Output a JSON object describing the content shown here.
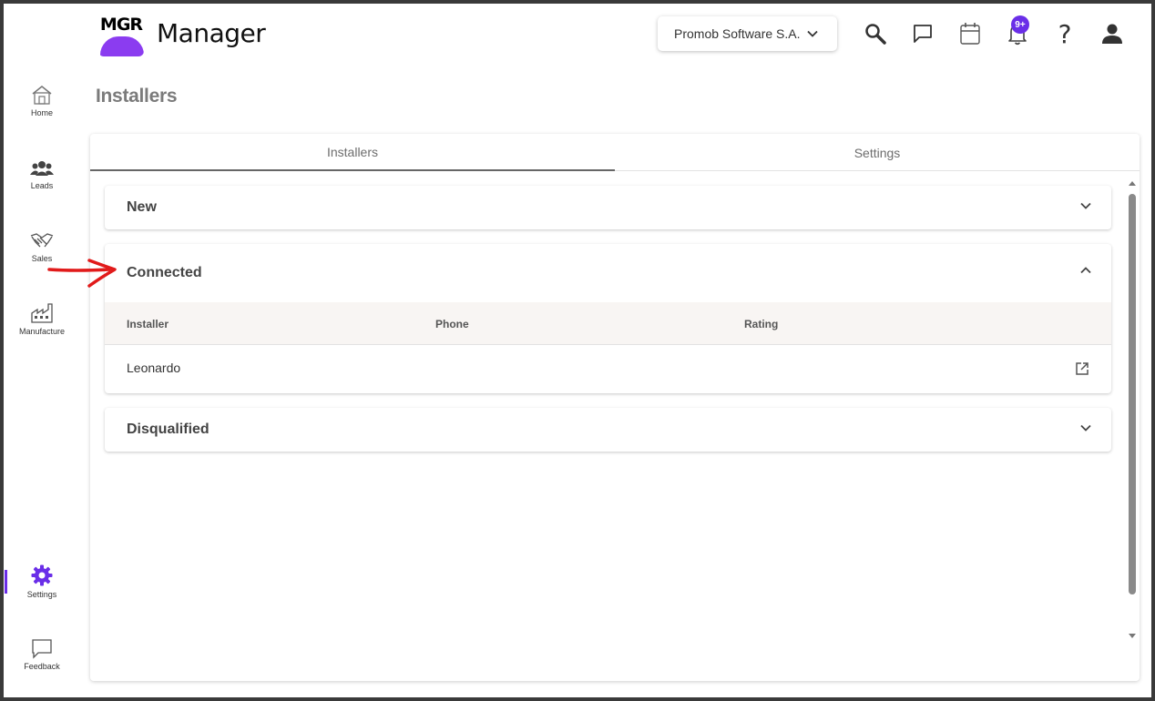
{
  "app": {
    "logo_text": "MGR",
    "title": "Manager"
  },
  "header": {
    "company": "Promob Software S.A.",
    "notification_badge": "9+",
    "icons": [
      "search-icon",
      "chat-icon",
      "calendar-icon",
      "bell-icon",
      "help-icon",
      "user-icon"
    ]
  },
  "sidebar": {
    "items": [
      {
        "label": "Home",
        "icon": "house-icon"
      },
      {
        "label": "Leads",
        "icon": "people-icon"
      },
      {
        "label": "Sales",
        "icon": "handshake-icon"
      },
      {
        "label": "Manufacture",
        "icon": "factory-icon"
      },
      {
        "label": "Settings",
        "icon": "gear-icon",
        "active": true
      },
      {
        "label": "Feedback",
        "icon": "feedback-icon"
      }
    ]
  },
  "page": {
    "title": "Installers",
    "tabs": [
      {
        "label": "Installers",
        "active": true
      },
      {
        "label": "Settings",
        "active": false
      }
    ],
    "sections": [
      {
        "title": "New",
        "expanded": false
      },
      {
        "title": "Connected",
        "expanded": true
      },
      {
        "title": "Disqualified",
        "expanded": false
      }
    ],
    "table": {
      "columns": [
        "Installer",
        "Phone",
        "Rating"
      ],
      "rows": [
        {
          "installer": "Leonardo",
          "phone": "",
          "rating": ""
        }
      ]
    }
  },
  "colors": {
    "accent": "#6a2ee8",
    "logo_purple": "#8b3cf0",
    "annotation_arrow": "#e11a1a"
  }
}
